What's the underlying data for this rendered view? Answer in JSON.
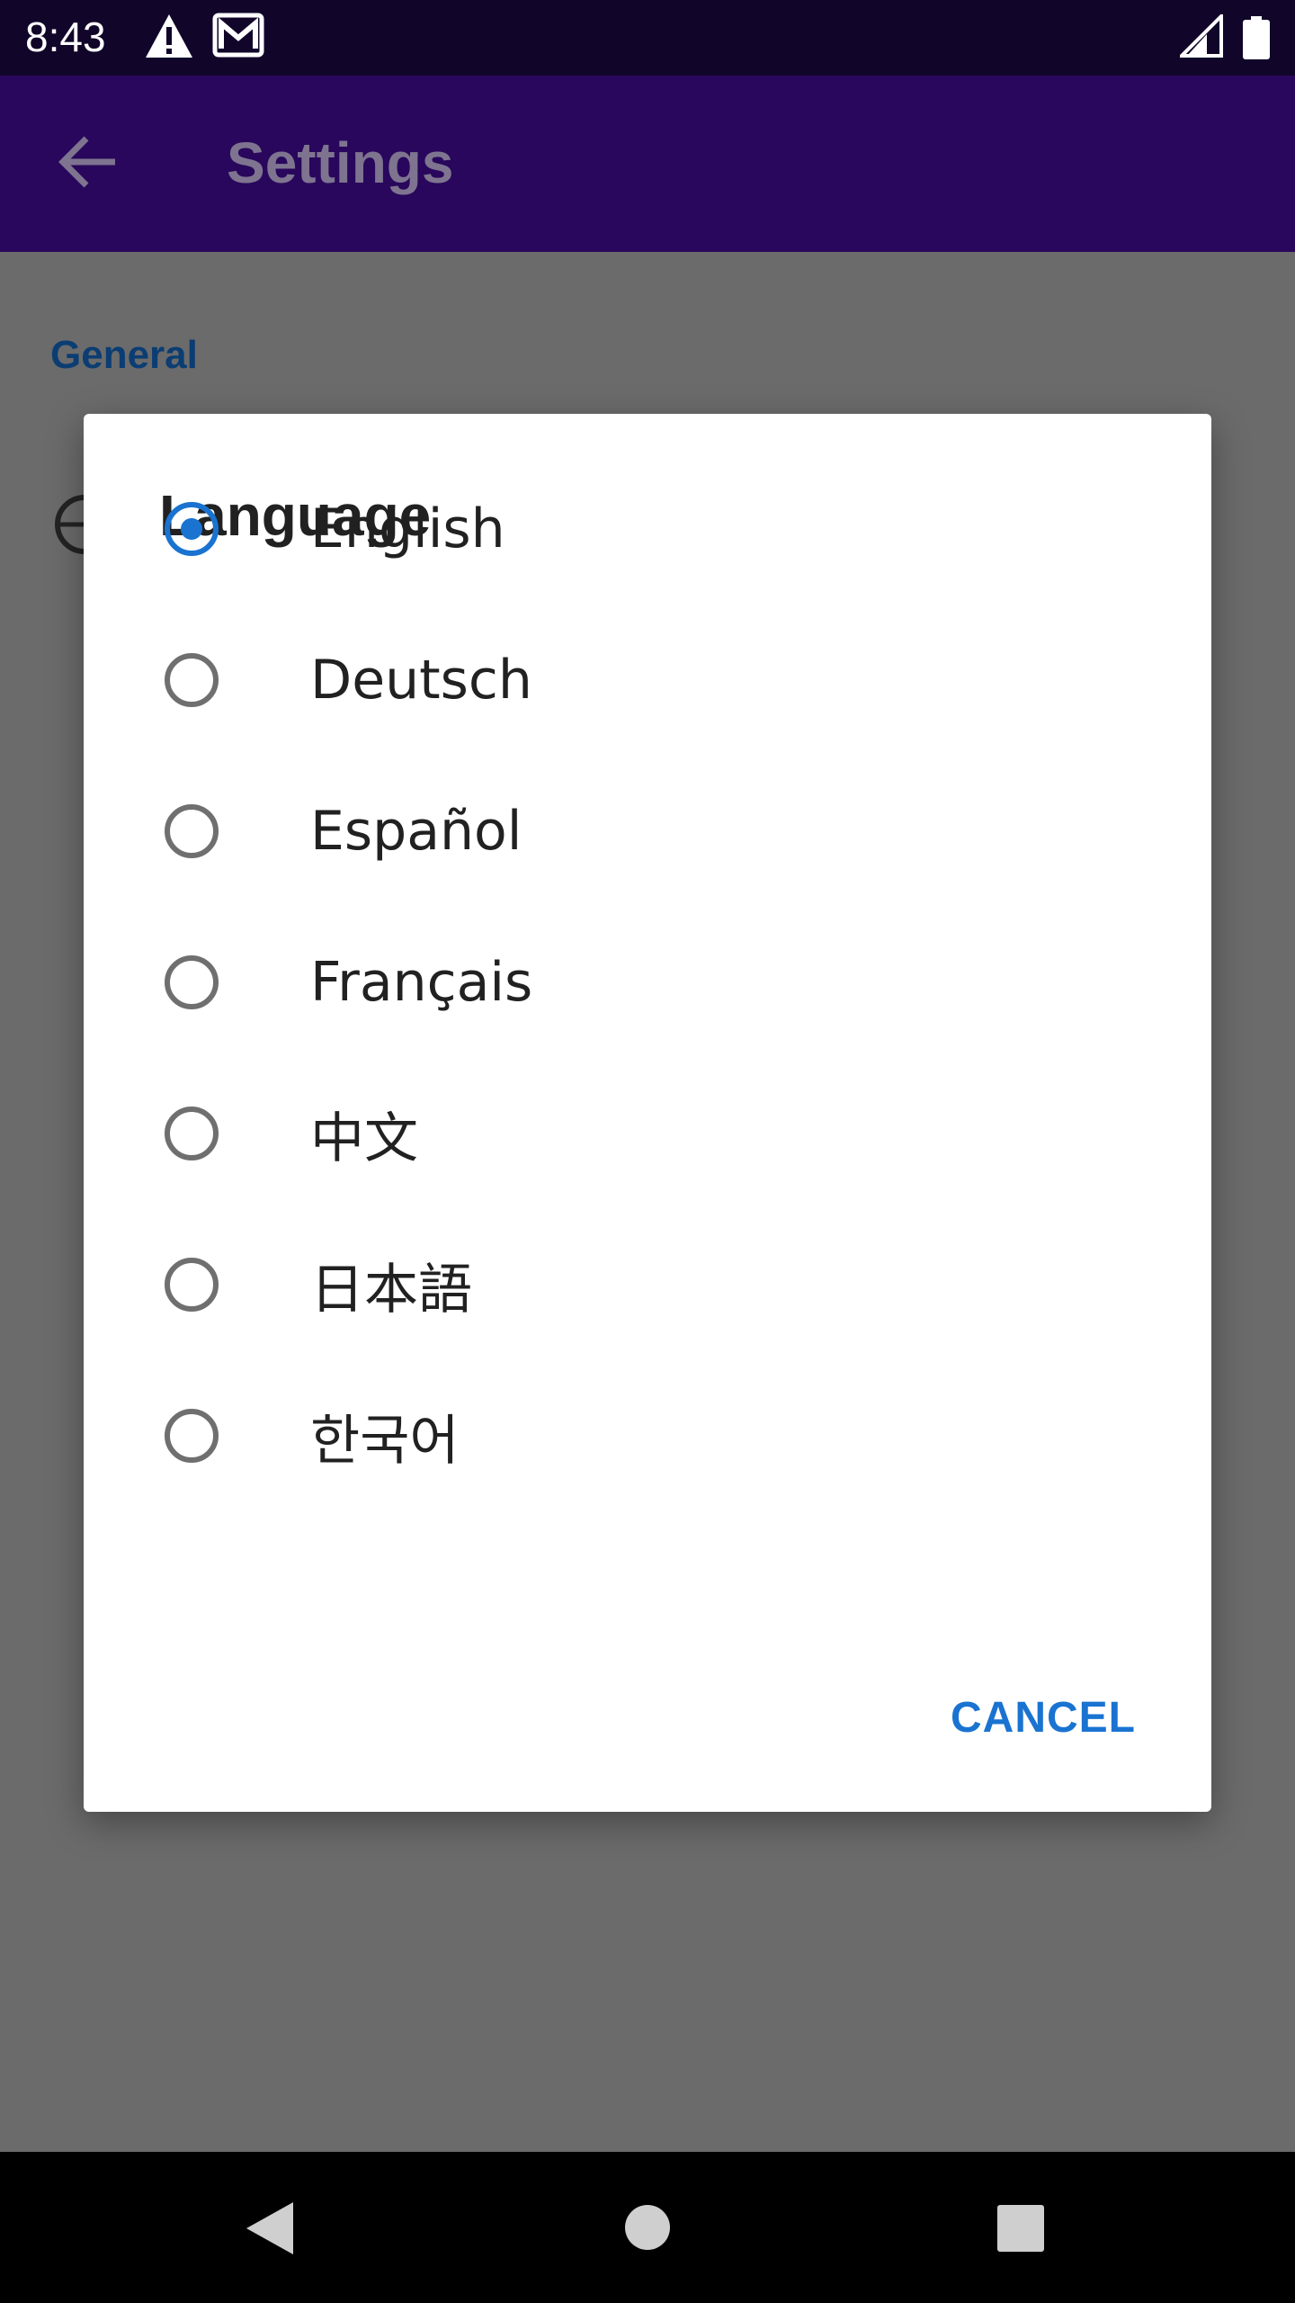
{
  "status_bar": {
    "time": "8:43",
    "icons": [
      "warning-icon",
      "mail-icon",
      "signal-icon",
      "battery-icon"
    ]
  },
  "app_bar": {
    "title": "Settings",
    "back_icon": "arrow-back-icon"
  },
  "background": {
    "section_header": "General",
    "item_icon": "globe-icon"
  },
  "dialog": {
    "title": "Language",
    "options": [
      {
        "label": "English",
        "selected": true
      },
      {
        "label": "Deutsch",
        "selected": false
      },
      {
        "label": "Español",
        "selected": false
      },
      {
        "label": "Français",
        "selected": false
      },
      {
        "label": "中文",
        "selected": false
      },
      {
        "label": "日本語",
        "selected": false
      },
      {
        "label": "한국어",
        "selected": false
      }
    ],
    "cancel_label": "CANCEL"
  },
  "nav_bar": {
    "icons": [
      "nav-back-icon",
      "nav-home-icon",
      "nav-recents-icon"
    ]
  },
  "colors": {
    "accent": "#1a73d1",
    "app_bar": "#29075c",
    "status_bar": "#11052a",
    "scrim": "#6b6b6b"
  }
}
